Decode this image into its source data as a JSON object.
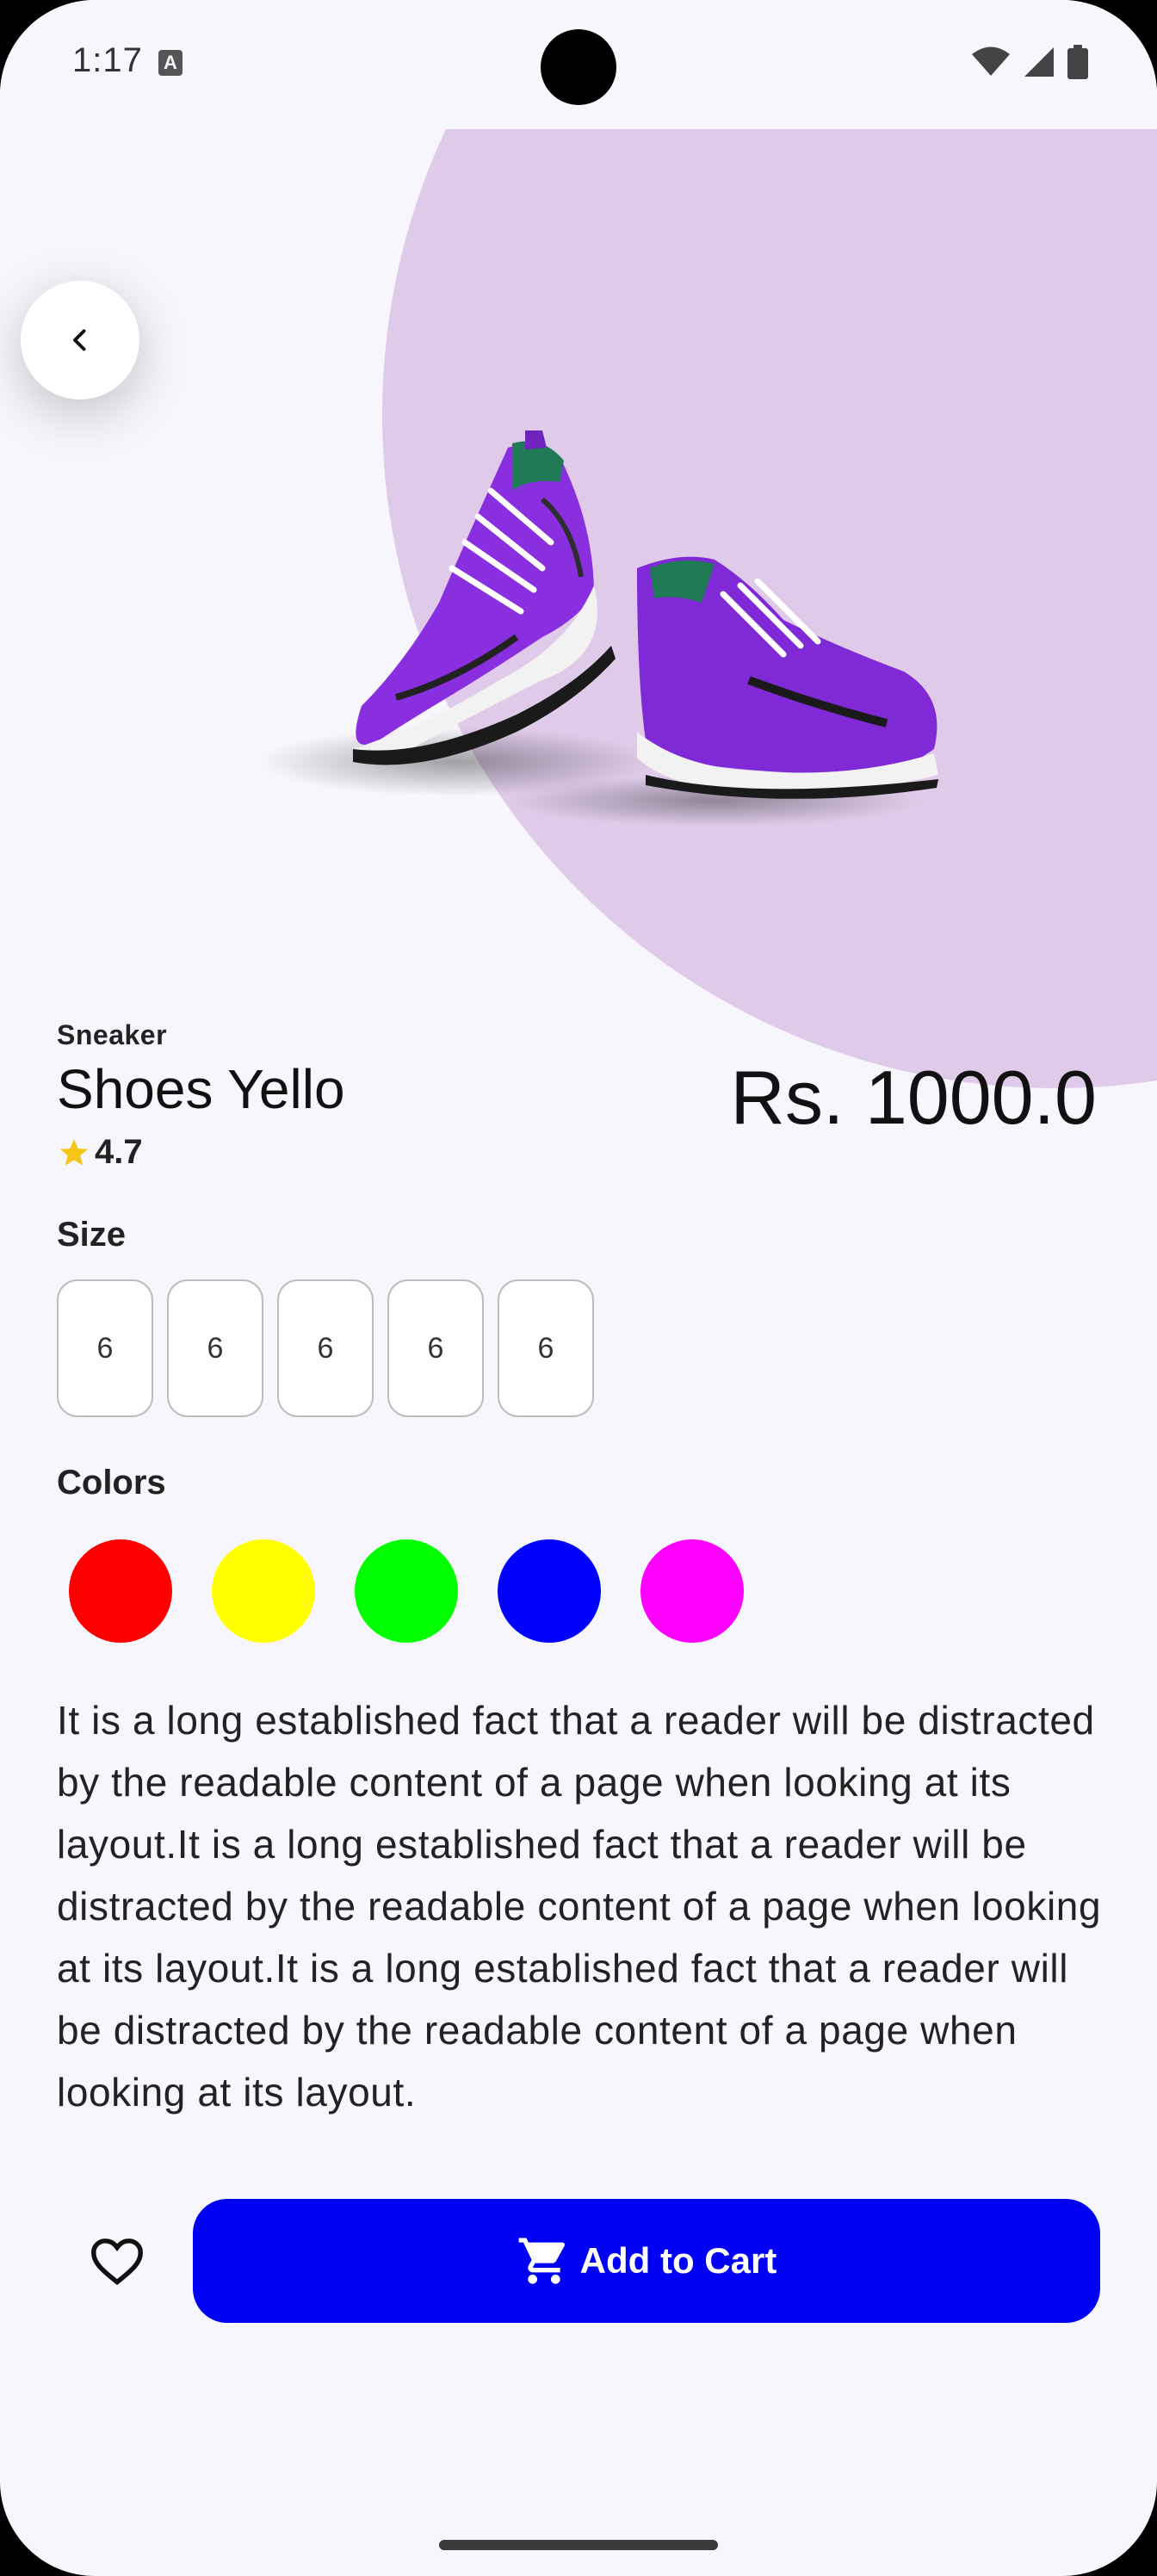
{
  "status_bar": {
    "time": "1:17",
    "notification_icon": "A"
  },
  "product": {
    "category": "Sneaker",
    "name": "Shoes Yello",
    "rating": "4.7",
    "price": "Rs. 1000.0",
    "image_icon": "purple-sneakers-image"
  },
  "size_section": {
    "title": "Size",
    "sizes": [
      "6",
      "6",
      "6",
      "6",
      "6"
    ]
  },
  "color_section": {
    "title": "Colors",
    "colors": [
      "#ff0000",
      "#ffff00",
      "#00ff00",
      "#0000ff",
      "#ff00ff"
    ]
  },
  "description": "It is a long established fact that a reader will be distracted by the readable content of a page when looking at its layout.It is a long established fact that a reader will be distracted by the readable content of a page when looking at its layout.It is a long established fact that a reader will be distracted by the readable content of a page when looking at its layout.",
  "actions": {
    "add_to_cart_label": "Add to Cart"
  },
  "theme": {
    "accent": "#0000f5",
    "hero_circle": "#dfcbe9",
    "background": "#f7f6fc"
  }
}
